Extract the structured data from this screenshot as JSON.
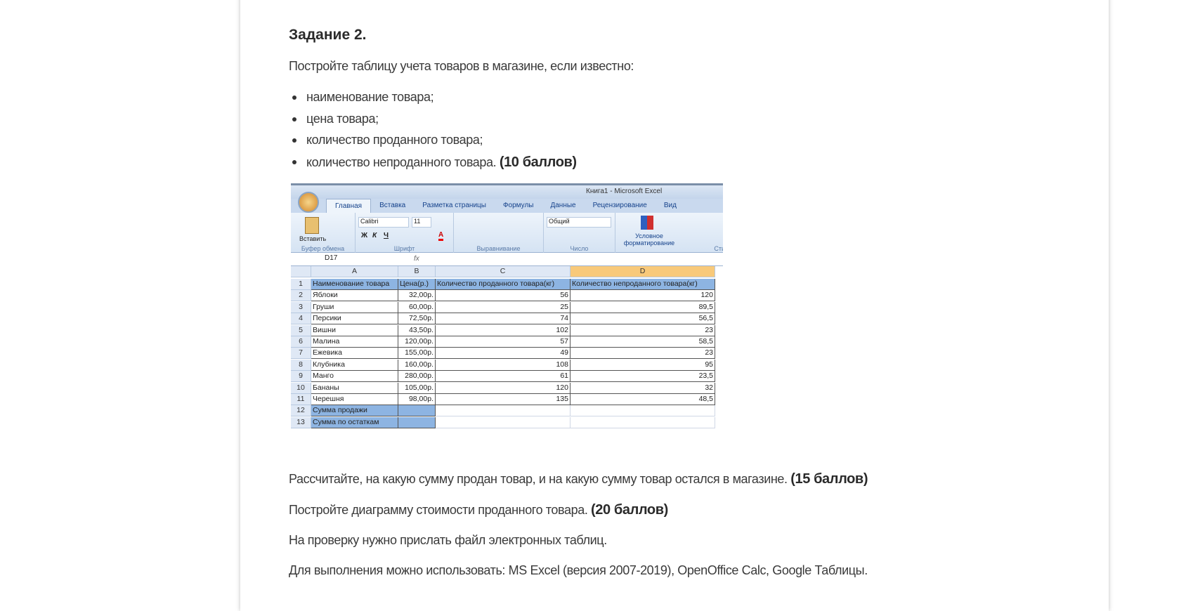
{
  "title": "Задание 2.",
  "intro": "Постройте таблицу учета товаров в магазине, если известно:",
  "bullets": [
    "наименование товара;",
    "цена товара;",
    "количество проданного товара;",
    "количество непроданного товара."
  ],
  "bullet_points": "(10 баллов)",
  "p1": "Рассчитайте, на какую сумму продан товар, и на какую сумму товар остался в магазине.",
  "p1_points": "(15 баллов)",
  "p2": "Постройте диаграмму стоимости проданного товара.",
  "p2_points": "(20 баллов)",
  "p3": "На проверку нужно прислать файл электронных таблиц.",
  "p4": "Для выполнения можно использовать: MS Excel (версия 2007-2019), OpenOffice Calc, Google Таблицы.",
  "excel": {
    "window_title": "Книга1 - Microsoft Excel",
    "tabs": [
      "Главная",
      "Вставка",
      "Разметка страницы",
      "Формулы",
      "Данные",
      "Рецензирование",
      "Вид"
    ],
    "groups": [
      "Буфер обмена",
      "Шрифт",
      "Выравнивание",
      "Число",
      "Сти"
    ],
    "paste": "Вставить",
    "font": "Calibri",
    "size": "11",
    "format": "Общий",
    "cond": "Условное форматирование",
    "bold": "Ж",
    "italic": "К",
    "underline": "Ч",
    "cell_ref": "D17",
    "fx": "fx",
    "cols": [
      "A",
      "B",
      "C",
      "D"
    ],
    "headers": [
      "Наименование товара",
      "Цена(р.)",
      "Количество проданного товара(кг)",
      "Количество непроданного товара(кг)"
    ],
    "rows": [
      [
        "Яблоки",
        "32,00р.",
        "56",
        "120"
      ],
      [
        "Груши",
        "60,00р.",
        "25",
        "89,5"
      ],
      [
        "Персики",
        "72,50р.",
        "74",
        "56,5"
      ],
      [
        "Вишни",
        "43,50р.",
        "102",
        "23"
      ],
      [
        "Малина",
        "120,00р.",
        "57",
        "58,5"
      ],
      [
        "Ежевика",
        "155,00р.",
        "49",
        "23"
      ],
      [
        "Клубника",
        "160,00р.",
        "108",
        "95"
      ],
      [
        "Манго",
        "280,00р.",
        "61",
        "23,5"
      ],
      [
        "Бананы",
        "105,00р.",
        "120",
        "32"
      ],
      [
        "Черешня",
        "98,00р.",
        "135",
        "48,5"
      ]
    ],
    "footer_rows": [
      "Сумма продажи",
      "Сумма по остаткам"
    ],
    "row_numbers": [
      "1",
      "2",
      "3",
      "4",
      "5",
      "6",
      "7",
      "8",
      "9",
      "10",
      "11",
      "12",
      "13"
    ]
  }
}
